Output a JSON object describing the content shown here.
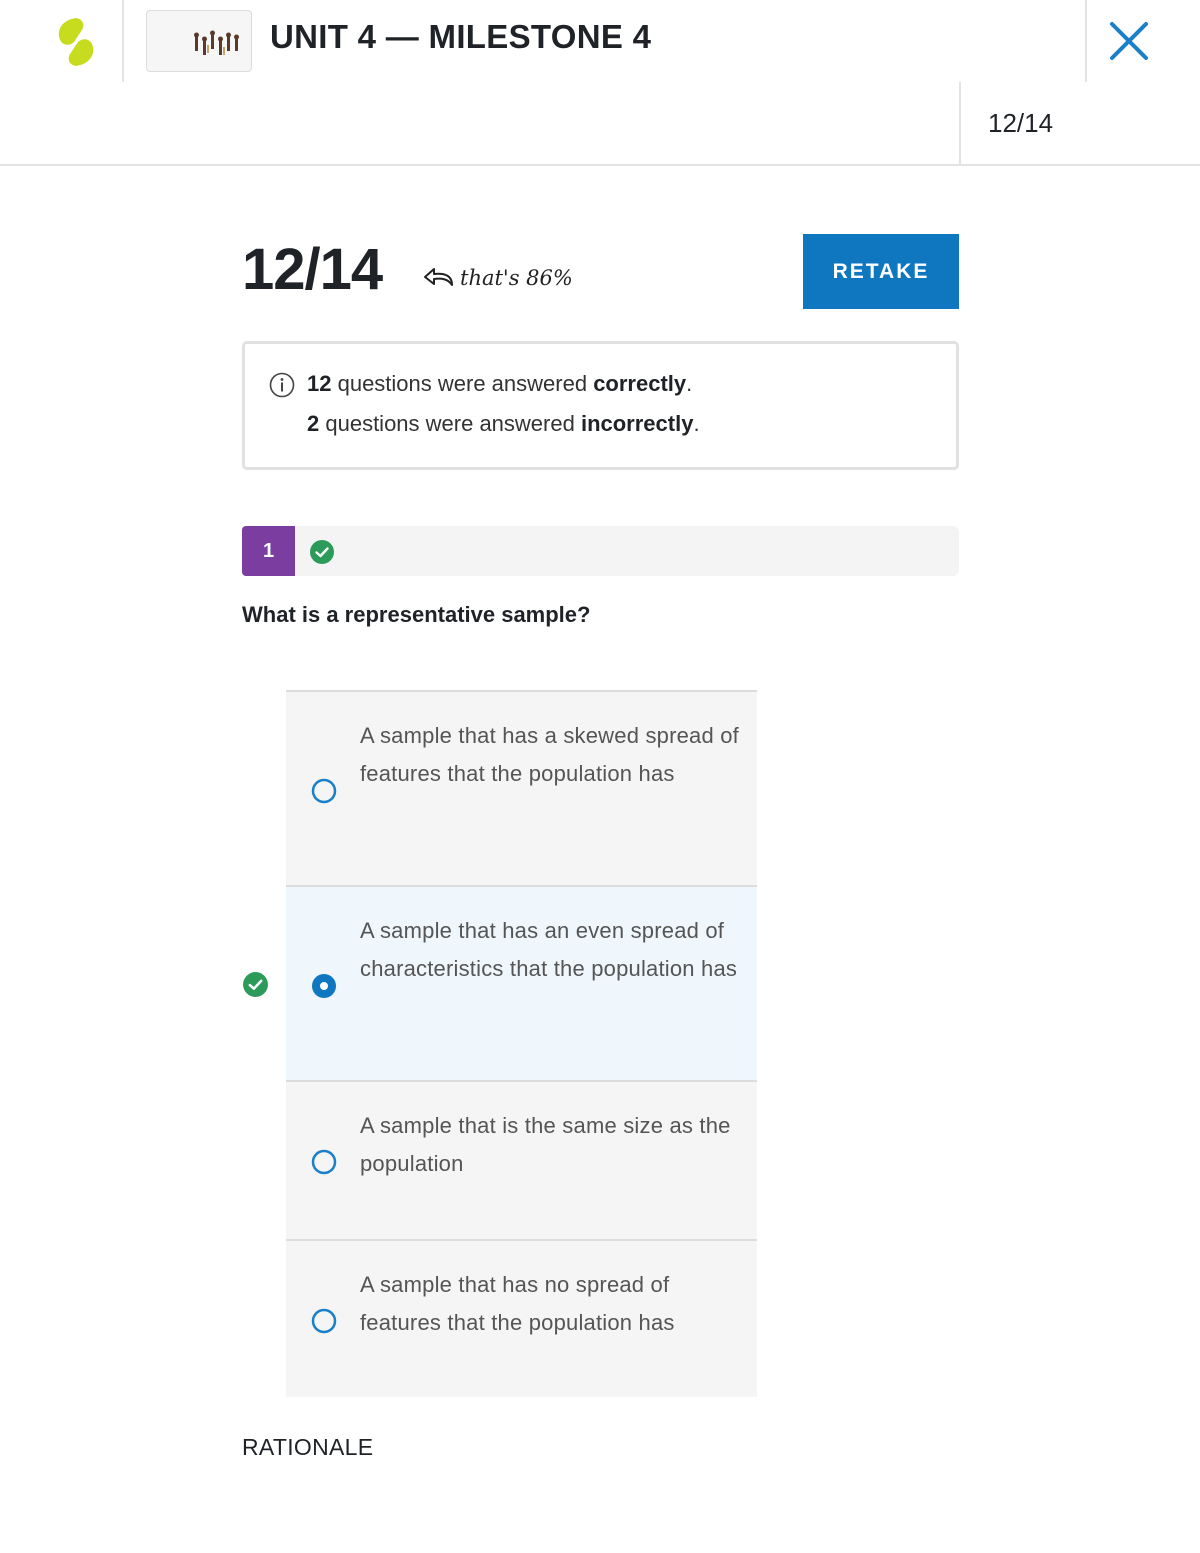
{
  "header": {
    "title": "UNIT 4 — MILESTONE 4",
    "logo_icon": "sophia-leaf-logo",
    "thumbnail_icon": "chess-pieces-thumbnail",
    "close_icon": "close-x-icon",
    "accent_color": "#0f76c0",
    "logo_color": "#c7dc1f"
  },
  "progress": {
    "label": "12/14"
  },
  "score": {
    "value": "12/14",
    "percent_note": "that's 86%",
    "retake_label": "RETAKE"
  },
  "summary": {
    "correct_count": "12",
    "correct_text": " questions were answered ",
    "correct_word": "correctly",
    "incorrect_count": "2",
    "incorrect_text": " questions were answered ",
    "incorrect_word": "incorrectly",
    "period": "."
  },
  "question": {
    "number": "1",
    "number_color": "#7b3ea0",
    "status": "correct",
    "text": "What is a representative sample?",
    "options": [
      {
        "text": "A sample that has a skewed spread of features that the population has",
        "selected": false
      },
      {
        "text": "A sample that has an even spread of characteristics that the population has",
        "selected": true,
        "correct": true
      },
      {
        "text": "A sample that is the same size as the population",
        "selected": false
      },
      {
        "text": "A sample that has no spread of features that the population has",
        "selected": false
      }
    ]
  },
  "rationale": {
    "label": "RATIONALE"
  }
}
